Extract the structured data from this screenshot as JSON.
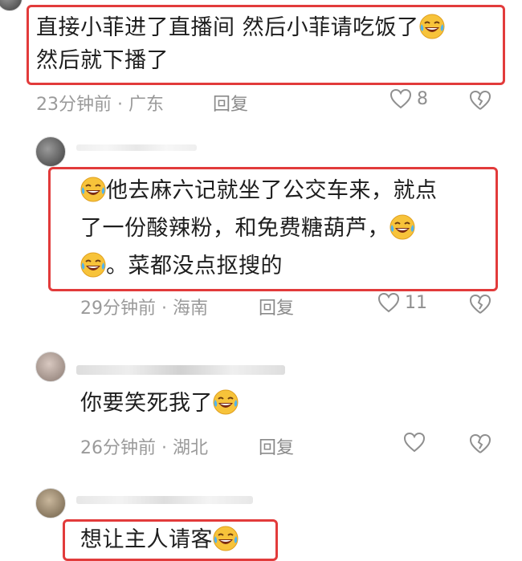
{
  "comments": [
    {
      "lines": [
        "直接小菲进了直播间 然后小菲请吃饭了",
        "然后就下播了"
      ],
      "emoji_name": "laughing-crying-emoji",
      "time": "23分钟前",
      "location": "广东",
      "reply_label": "回复",
      "likes": "8"
    },
    {
      "lines": [
        "他去麻六记就坐了公交车来，就点",
        "了一份酸辣粉，和免费糖葫芦，",
        "。菜都没点抠搜的"
      ],
      "emoji_name": "laughing-crying-emoji",
      "time": "29分钟前",
      "location": "海南",
      "reply_label": "回复",
      "likes": "11"
    },
    {
      "lines": [
        "你要笑死我了"
      ],
      "emoji_name": "laughing-crying-emoji",
      "time": "26分钟前",
      "location": "湖北",
      "reply_label": "回复",
      "likes": ""
    },
    {
      "lines": [
        "想让主人请客"
      ],
      "emoji_name": "laughing-crying-emoji"
    }
  ],
  "meta_separator": "·",
  "icons": {
    "like": "heart-outline-icon",
    "dislike": "broken-heart-icon"
  },
  "colors": {
    "highlight": "#e23b3b",
    "meta_text": "#9a9a9a"
  }
}
